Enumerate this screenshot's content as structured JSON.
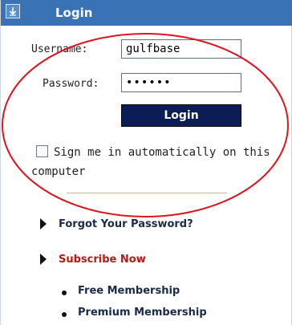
{
  "header": {
    "title": "Login",
    "collapse_icon": "collapse-arrow-icon"
  },
  "form": {
    "username_label": "Username:",
    "username_value": "gulfbase",
    "password_label": "Password:",
    "password_value": "••••••",
    "login_button": "Login",
    "auto_signin_text": "Sign me in automatically on this computer",
    "auto_signin_checked": false
  },
  "links": {
    "forgot_password": "Forgot Your Password?",
    "subscribe_now": "Subscribe Now",
    "sub_options": [
      "Free Membership",
      "Premium Membership"
    ]
  },
  "colors": {
    "header_bg": "#3a73b5",
    "button_bg": "#0b1d54",
    "annotation_red": "#e0141e",
    "subscribe_red": "#c0160f"
  }
}
